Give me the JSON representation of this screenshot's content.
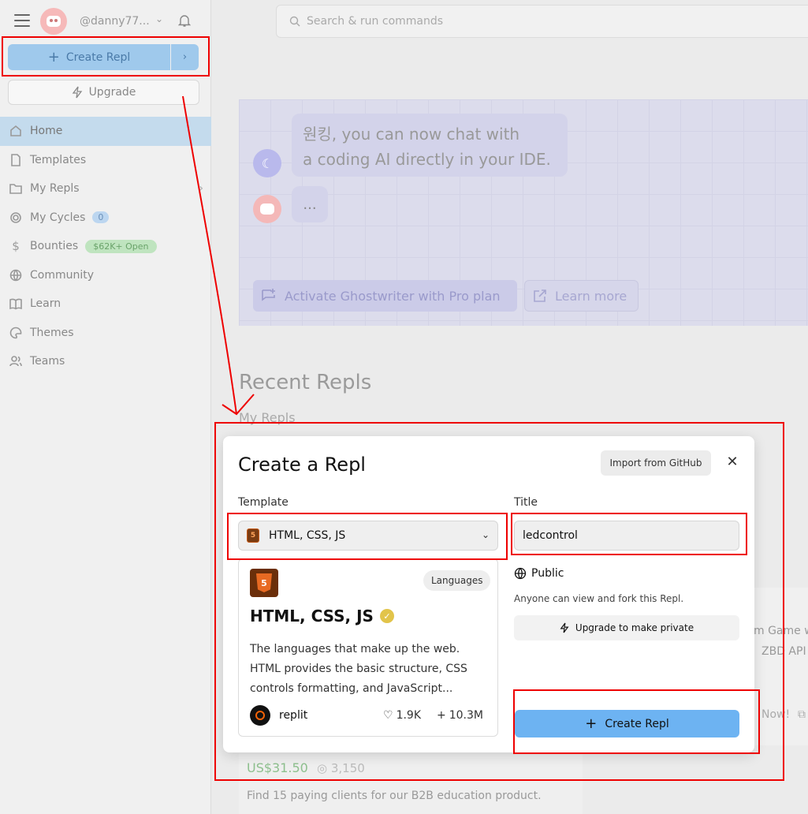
{
  "sidebar": {
    "username": "@danny77...",
    "create_label": "Create Repl",
    "upgrade_label": "Upgrade",
    "items": [
      {
        "label": "Home",
        "badge": ""
      },
      {
        "label": "Templates",
        "badge": ""
      },
      {
        "label": "My Repls",
        "badge": ""
      },
      {
        "label": "My Cycles",
        "badge": "0"
      },
      {
        "label": "Bounties",
        "badge": "$62K+ Open"
      },
      {
        "label": "Community",
        "badge": ""
      },
      {
        "label": "Learn",
        "badge": ""
      },
      {
        "label": "Themes",
        "badge": ""
      },
      {
        "label": "Teams",
        "badge": ""
      }
    ]
  },
  "search": {
    "placeholder": "Search & run commands"
  },
  "banner": {
    "message_line1": "원킹, you can now chat with",
    "message_line2": "a coding AI directly in your IDE.",
    "reply": "...",
    "activate_label": "Activate Ghostwriter with Pro plan",
    "learn_more_label": "Learn more"
  },
  "recent": {
    "title": "Recent Repls",
    "subtitle": "My Repls"
  },
  "bounty": {
    "price": "US$31.50",
    "cycles": "3,150",
    "description": "Find 15 paying clients for our B2B education product."
  },
  "side_card": {
    "line1": "m Game w",
    "line2": "ZBD API",
    "line3": "Now!"
  },
  "modal": {
    "title": "Create a Repl",
    "import_label": "Import from GitHub",
    "close_glyph": "✕",
    "template_label": "Template",
    "title_label": "Title",
    "selected_template": "HTML, CSS, JS",
    "title_value": "ledcontrol",
    "card": {
      "badge": "Languages",
      "name": "HTML, CSS, JS",
      "description": "The languages that make up the web. HTML provides the basic structure, CSS controls formatting, and JavaScript...",
      "owner": "replit",
      "likes": "1.9K",
      "forks": "10.3M"
    },
    "visibility": "Public",
    "visibility_desc": "Anyone can view and fork this Repl.",
    "upgrade_private_label": "Upgrade to make private",
    "create_label": "Create Repl"
  },
  "colors": {
    "accent_blue": "#6db3f2",
    "highlight_red": "#ee0000",
    "active_nav": "#c4dbed"
  }
}
